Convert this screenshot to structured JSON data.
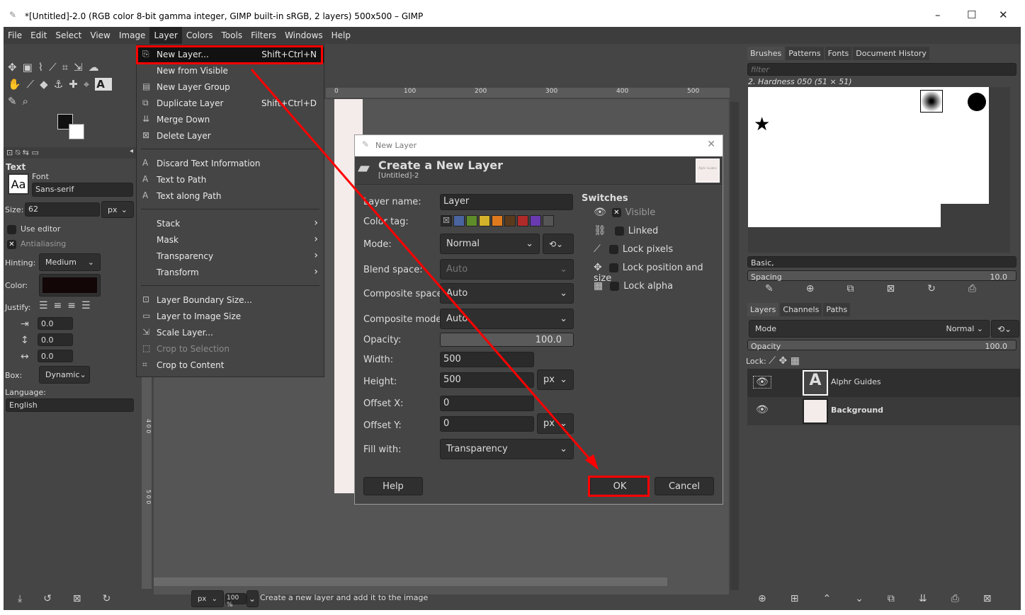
{
  "window": {
    "title": "*[Untitled]-2.0 (RGB color 8-bit gamma integer, GIMP built-in sRGB, 2 layers) 500x500 – GIMP",
    "minimize": "–",
    "maximize": "☐",
    "close": "✕"
  },
  "menubar": [
    "File",
    "Edit",
    "Select",
    "View",
    "Image",
    "Layer",
    "Colors",
    "Tools",
    "Filters",
    "Windows",
    "Help"
  ],
  "layer_menu": {
    "group1": [
      {
        "label": "New Layer...",
        "shortcut": "Shift+Ctrl+N",
        "icon": "new-layer-icon"
      },
      {
        "label": "New from Visible"
      },
      {
        "label": "New Layer Group",
        "icon": "layer-group-icon"
      },
      {
        "label": "Duplicate Layer",
        "shortcut": "Shift+Ctrl+D",
        "icon": "duplicate-icon"
      },
      {
        "label": "Merge Down",
        "icon": "merge-down-icon"
      },
      {
        "label": "Delete Layer",
        "icon": "delete-icon"
      }
    ],
    "group2": [
      {
        "label": "Discard Text Information"
      },
      {
        "label": "Text to Path"
      },
      {
        "label": "Text along Path"
      }
    ],
    "group3": [
      {
        "label": "Stack"
      },
      {
        "label": "Mask"
      },
      {
        "label": "Transparency"
      },
      {
        "label": "Transform"
      }
    ],
    "group4": [
      {
        "label": "Layer Boundary Size..."
      },
      {
        "label": "Layer to Image Size"
      },
      {
        "label": "Scale Layer..."
      },
      {
        "label": "Crop to Selection",
        "disabled": true
      },
      {
        "label": "Crop to Content"
      }
    ]
  },
  "tool_options": {
    "title": "Text",
    "font_label": "Font",
    "font_preview": "Aa",
    "font": "Sans-serif",
    "size_label": "Size:",
    "size": "62",
    "size_unit": "px",
    "use_editor": "Use editor",
    "antialiasing": "Antialiasing",
    "hinting_label": "Hinting:",
    "hinting": "Medium",
    "color_label": "Color:",
    "color": "#120606",
    "justify_label": "Justify:",
    "indent": "0.0",
    "line_spacing": "0.0",
    "letter_spacing": "0.0",
    "box_label": "Box:",
    "box": "Dynamic",
    "language_label": "Language:",
    "language": "English"
  },
  "rulers": {
    "top": [
      "0",
      "100",
      "200",
      "300",
      "400",
      "500"
    ],
    "left": [
      "4 0 0",
      "5 0 0"
    ]
  },
  "statusbar": {
    "unit": "px",
    "zoom": "100 %",
    "message": "Create a new layer and add it to the image"
  },
  "dialog": {
    "window_title": "New Layer",
    "heading": "Create a New Layer",
    "subtitle": "[Untitled]-2",
    "thumb_text": "Alphr Guides",
    "layer_name_label": "Layer name:",
    "layer_name": "Layer",
    "color_tag_label": "Color tag:",
    "color_tags": [
      "#4a64a0",
      "#5e8c2a",
      "#d4b22a",
      "#e07a1e",
      "#5a3a1c",
      "#b02a2a",
      "#6a3ab0",
      "#555555"
    ],
    "mode_label": "Mode:",
    "mode": "Normal",
    "blend_label": "Blend space:",
    "blend": "Auto",
    "comp_space_label": "Composite space:",
    "comp_space": "Auto",
    "comp_mode_label": "Composite mode:",
    "comp_mode": "Auto",
    "opacity_label": "Opacity:",
    "opacity": "100.0",
    "width_label": "Width:",
    "width": "500",
    "height_label": "Height:",
    "height": "500",
    "unit": "px",
    "offx_label": "Offset X:",
    "offx": "0",
    "offy_label": "Offset Y:",
    "offy": "0",
    "fill_label": "Fill with:",
    "fill": "Transparency",
    "switches_title": "Switches",
    "switches": [
      "Visible",
      "Linked",
      "Lock pixels",
      "Lock position and size",
      "Lock alpha"
    ],
    "help": "Help",
    "ok": "OK",
    "cancel": "Cancel"
  },
  "right": {
    "tabs": [
      "Brushes",
      "Patterns",
      "Fonts",
      "Document History"
    ],
    "filter_placeholder": "filter",
    "brush_name": "2. Hardness 050 (51 × 51)",
    "tag": "Basic,",
    "spacing_label": "Spacing",
    "spacing": "10.0",
    "layer_tabs": [
      "Layers",
      "Channels",
      "Paths"
    ],
    "mode_label": "Mode",
    "mode": "Normal",
    "opacity_label": "Opacity",
    "opacity": "100.0",
    "lock_label": "Lock:",
    "layers": [
      {
        "name": "Alphr Guides"
      },
      {
        "name": "Background"
      }
    ]
  },
  "annotation_color": "#ff0000"
}
